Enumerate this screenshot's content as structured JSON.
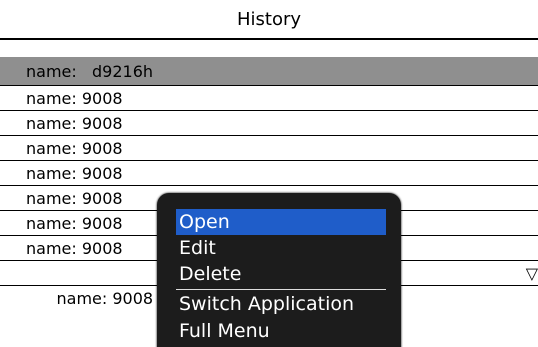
{
  "header": {
    "title": "History"
  },
  "history": {
    "items": [
      {
        "label": "name:   d9216h"
      },
      {
        "label": "name: 9008"
      },
      {
        "label": "name: 9008"
      },
      {
        "label": "name: 9008"
      },
      {
        "label": "name: 9008"
      },
      {
        "label": "name: 9008"
      },
      {
        "label": "name: 9008"
      },
      {
        "label": "name: 9008"
      },
      {
        "label": "name: 9008"
      }
    ],
    "scroll_indicator": "▽"
  },
  "context_menu": {
    "items": [
      {
        "label": "Open"
      },
      {
        "label": "Edit"
      },
      {
        "label": "Delete"
      },
      {
        "label": "Switch Application"
      },
      {
        "label": "Full Menu"
      }
    ]
  },
  "colors": {
    "selected_row": "#8f8f8f",
    "menu_background": "#1c1c1c",
    "menu_highlight": "#1f5dc9"
  }
}
